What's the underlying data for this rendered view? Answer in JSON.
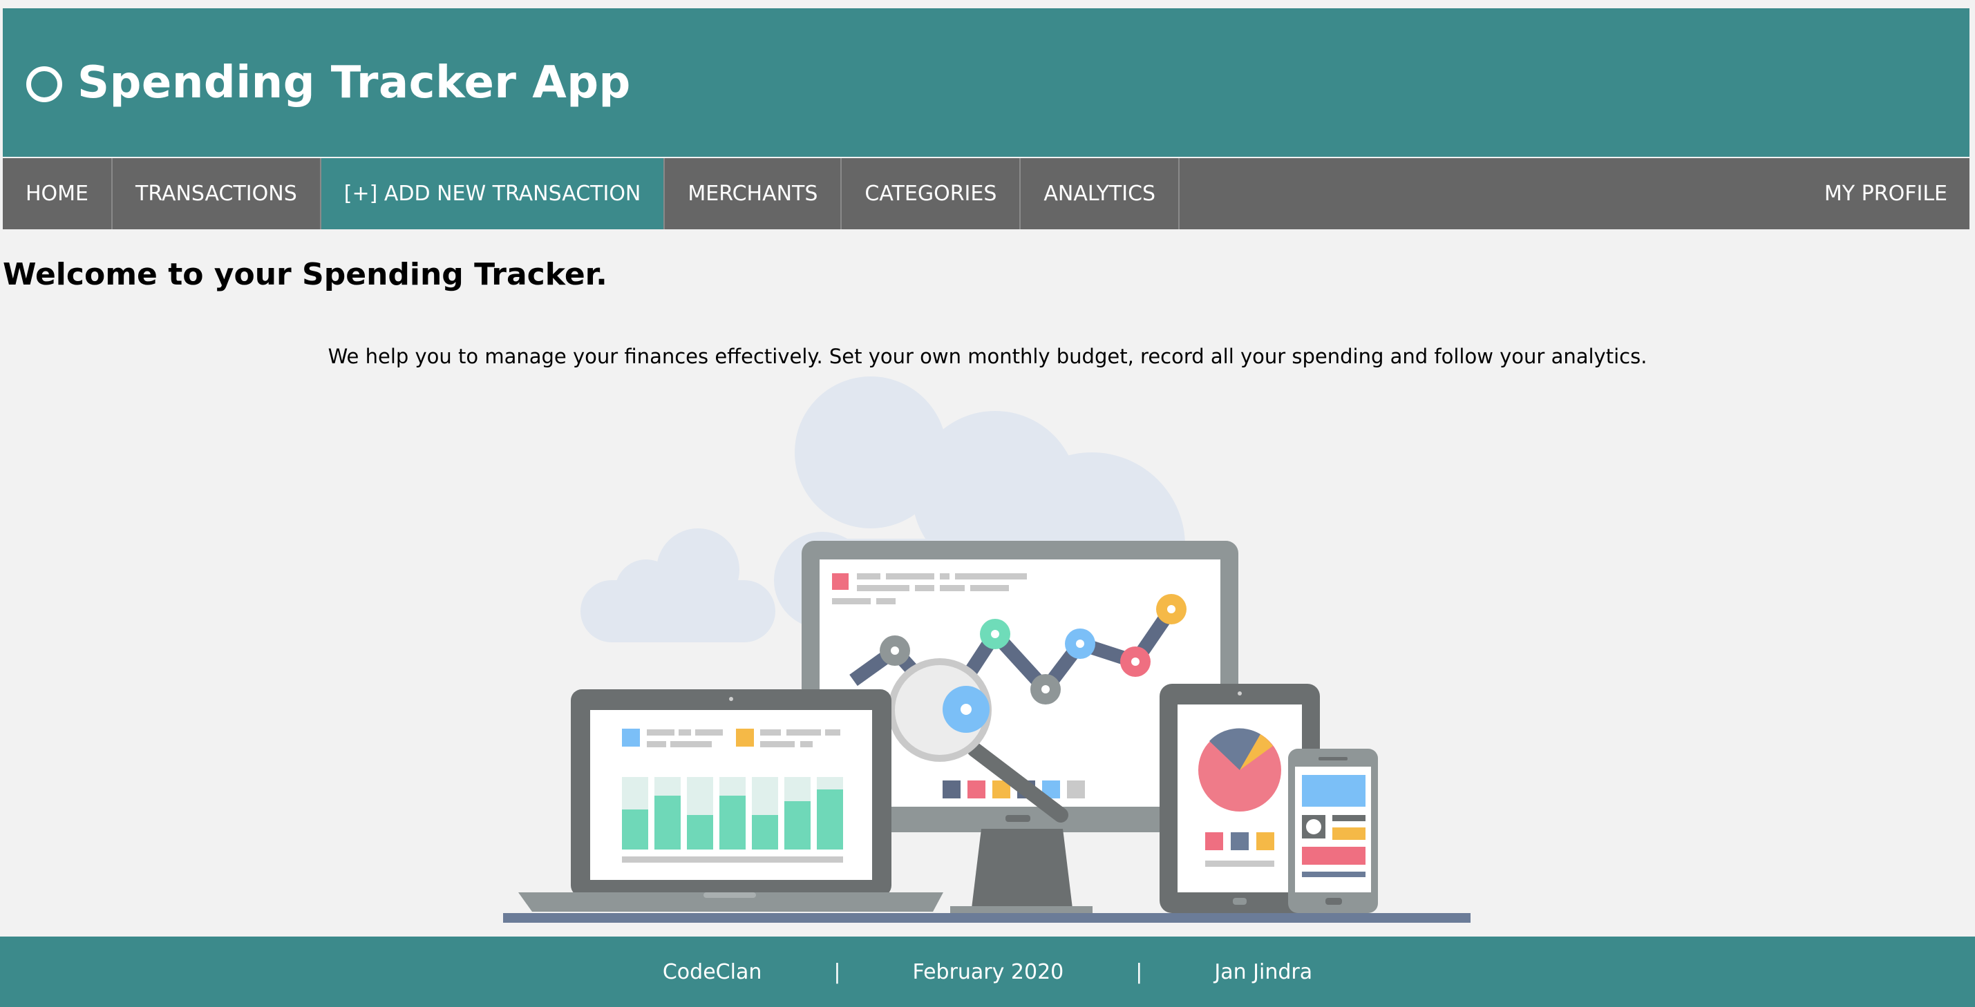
{
  "app": {
    "title": "Spending Tracker App",
    "logo_icon": "circle-logo-icon"
  },
  "nav": {
    "items": [
      {
        "label": "HOME"
      },
      {
        "label": "TRANSACTIONS"
      },
      {
        "label": "[+] ADD NEW TRANSACTION",
        "active": true
      },
      {
        "label": "MERCHANTS"
      },
      {
        "label": "CATEGORIES"
      },
      {
        "label": "ANALYTICS"
      }
    ],
    "profile_label": "MY PROFILE"
  },
  "main": {
    "heading": "Welcome to your Spending Tracker.",
    "intro": "We help you to manage your finances effectively. Set your own monthly budget, record all your spending and follow your analytics."
  },
  "footer": {
    "company": "CodeClan",
    "date": "February 2020",
    "author": "Jan Jindra",
    "separator": "|"
  },
  "colors": {
    "header_bg": "#3c8a8b",
    "nav_bg": "#666666",
    "page_bg": "#f2f2f2"
  }
}
